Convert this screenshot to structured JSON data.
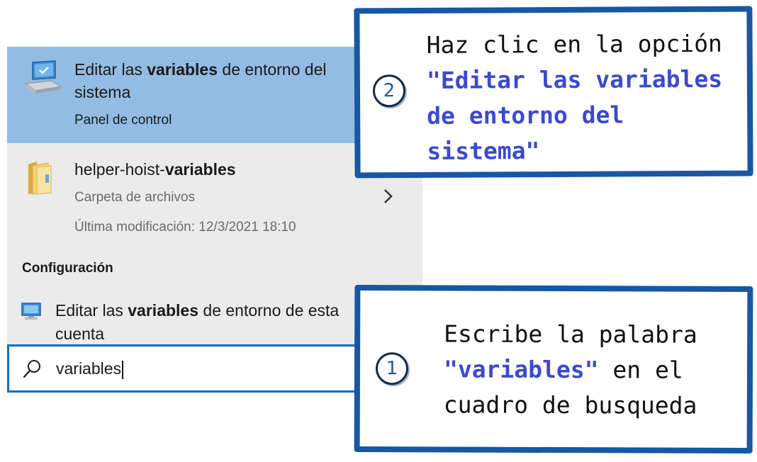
{
  "search_results": {
    "best_match": {
      "title_pre": "Editar las ",
      "title_bold": "variables",
      "title_post": " de entorno del sistema",
      "subtitle": "Panel de control",
      "icon": "computer-icon"
    },
    "folder_result": {
      "title_pre": "helper-hoist-",
      "title_bold": "variables",
      "type_label": "Carpeta de archivos",
      "modified_label": "Última modificación: 12/3/2021 18:10",
      "icon": "folder-icon",
      "expand_icon": "chevron-right-icon"
    },
    "section_heading": "Configuración",
    "setting_result": {
      "title_pre": "Editar las ",
      "title_bold": "variables",
      "title_post": " de entorno de esta cuenta",
      "icon": "monitor-icon"
    }
  },
  "search_box": {
    "value": "variables",
    "icon": "search-icon"
  },
  "callouts": [
    {
      "step": "2",
      "text_pre": "Haz clic en la opción ",
      "text_highlight": "\"Editar las variables de entorno del sistema\"",
      "text_post": ""
    },
    {
      "step": "1",
      "text_pre": "Escribe la palabra ",
      "text_highlight": "\"variables\"",
      "text_post": " en el cuadro de busqueda"
    }
  ],
  "colors": {
    "panel_bg": "#ebebeb",
    "selected_bg": "#92bce3",
    "callout_border": "#1657a6",
    "highlight_text": "#3a4ad1",
    "search_border": "#0a6cd4"
  }
}
